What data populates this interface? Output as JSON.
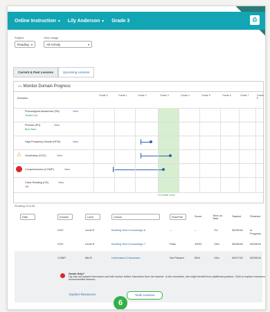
{
  "topbar": {
    "app": "Online Instruction",
    "student": "Lily Anderson",
    "grade": "Grade 3",
    "print_icon": "print-icon"
  },
  "filters": {
    "subject_label": "Subject",
    "subject_value": "Reading",
    "view_label": "View Usage",
    "view_value": "All Activity"
  },
  "tabs": [
    "Current & Past Lessons",
    "Upcoming Lessons"
  ],
  "panel": {
    "title": "Monitor Domain Progress",
    "domains_header": "Domains",
    "grades": [
      "Grade K",
      "Grade 1",
      "Grade 2",
      "Grade 3",
      "Grade 4",
      "Grade 5",
      "Grade 6",
      "Grade 7",
      "Grade 8"
    ],
    "on_grade_label": "On Grade Level",
    "domains": [
      {
        "name": "Phonological Awareness (PA)",
        "link": "View",
        "status": "Tested Out"
      },
      {
        "name": "Phonics (PH)",
        "link": "View",
        "status": "Blue Bars"
      },
      {
        "name": "High-Frequency Words (HFW)",
        "link": "View",
        "status": ""
      },
      {
        "name": "Vocabulary (VOC)",
        "link": "View",
        "status": ""
      },
      {
        "name": "Comprehension (COMP)",
        "link": "View",
        "status": ""
      },
      {
        "name": "Close Reading (CR)",
        "link": "View",
        "status": "Off"
      }
    ]
  },
  "lessons_label": "Showing 23 of 53",
  "table": {
    "headers": [
      "Date",
      "Domain",
      "Level",
      "Lesson",
      "Pass/Fail",
      "Score",
      "Time on Task",
      "Started",
      "Finished"
    ],
    "rows": [
      {
        "domain": "VOC",
        "level": "Level E",
        "lesson": "Building Word Knowledge 6",
        "pass": "--",
        "score": "--",
        "time": "7m",
        "started": "05/29/18",
        "finished": "In Progress"
      },
      {
        "domain": "VOC",
        "level": "Level E",
        "lesson": "Building Word Knowledge 7",
        "pass": "Pass",
        "score": "100%",
        "time": "13m",
        "started": "05/28/18",
        "finished": "05/28/18"
      },
      {
        "domain": "COMP",
        "level": "Mid E",
        "lesson": "Understand Characters",
        "pass": "Not Passed",
        "score": "55%",
        "time": "13m",
        "started": "05/27/18",
        "finished": "05/28/18"
      }
    ]
  },
  "alert": {
    "title": "Needs Help?",
    "body": "Lily has not passed this lesson and will receive further instruction from her teacher. In the meantime, she might benefit from additional practice. Click to explore resources or view recommended lessons."
  },
  "buttons": {
    "explore": "Explore Resources",
    "tools": "Tools Lessons"
  },
  "badge": "6"
}
